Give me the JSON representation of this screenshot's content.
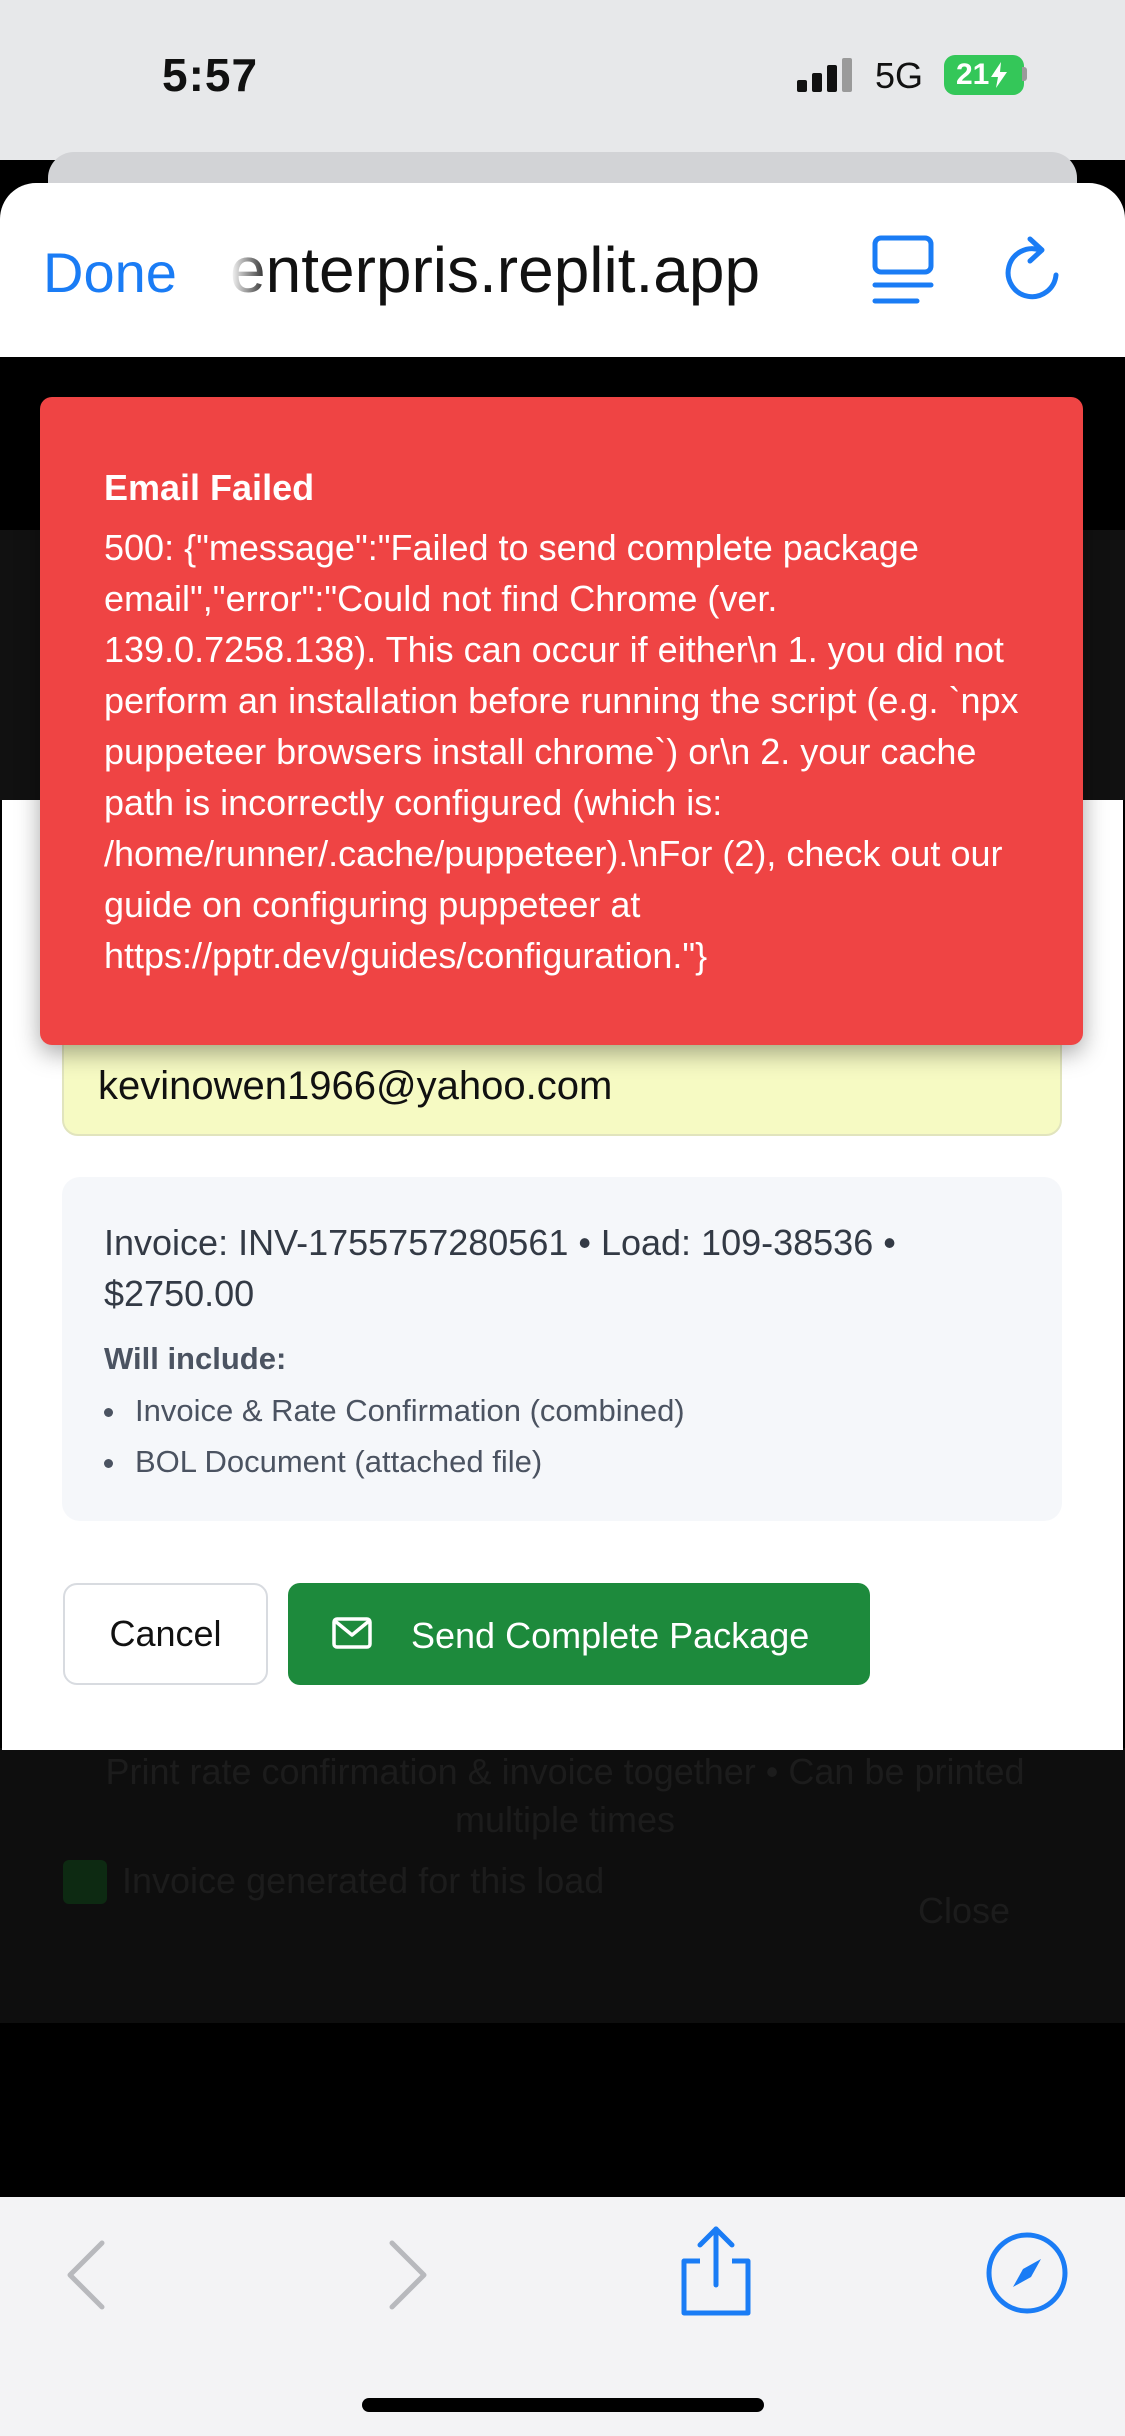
{
  "status_bar": {
    "time": "5:57",
    "network": "5G",
    "battery": "21"
  },
  "browser": {
    "done_label": "Done",
    "url": "enterpris.replit.app",
    "reader_icon": "reader-view-icon",
    "reload_icon": "reload-icon"
  },
  "toast": {
    "title": "Email Failed",
    "message": "500: {\"message\":\"Failed to send complete package email\",\"error\":\"Could not find Chrome (ver. 139.0.7258.138). This can occur if either\\n 1. you did not perform an installation before running the script (e.g. `npx puppeteer browsers install chrome`) or\\n 2. your cache path is incorrectly configured (which is: /home/runner/.cache/puppeteer).\\nFor (2), check out our guide on configuring puppeteer at https://pptr.dev/guides/configuration.\"}",
    "color": "#ef4444"
  },
  "modal": {
    "email_value": "kevinowen1966@yahoo.com",
    "invoice_line": "Invoice: INV-1755757280561 • Load: 109-38536 • $2750.00",
    "will_include_label": "Will include:",
    "include_items": [
      "Invoice & Rate Confirmation (combined)",
      "BOL Document (attached file)"
    ],
    "cancel_label": "Cancel",
    "send_label": "Send Complete Package",
    "send_color": "#1d8a3c"
  },
  "background_page": {
    "print_note": "Print rate confirmation & invoice together • Can be printed multiple times",
    "invoice_generated": "Invoice generated for this load",
    "close_label": "Close"
  },
  "toolbar": {
    "icons": [
      "back-icon",
      "forward-icon",
      "share-icon",
      "compass-icon"
    ]
  }
}
